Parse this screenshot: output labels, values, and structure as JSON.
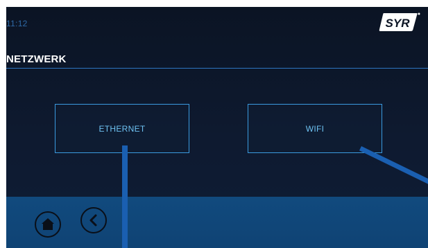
{
  "status": {
    "time": "11:12"
  },
  "brand": {
    "logo_text": "SYR"
  },
  "page": {
    "title": "NETZWERK"
  },
  "options": [
    {
      "label": "ETHERNET"
    },
    {
      "label": "WIFI"
    }
  ],
  "nav": {
    "home_icon": "home-icon",
    "back_icon": "chevron-left-icon"
  },
  "colors": {
    "screen_bg": "#0b1424",
    "accent_blue": "#3a9be0",
    "bottom_bar": "#114a7e",
    "pointer": "#1a5fb1"
  }
}
